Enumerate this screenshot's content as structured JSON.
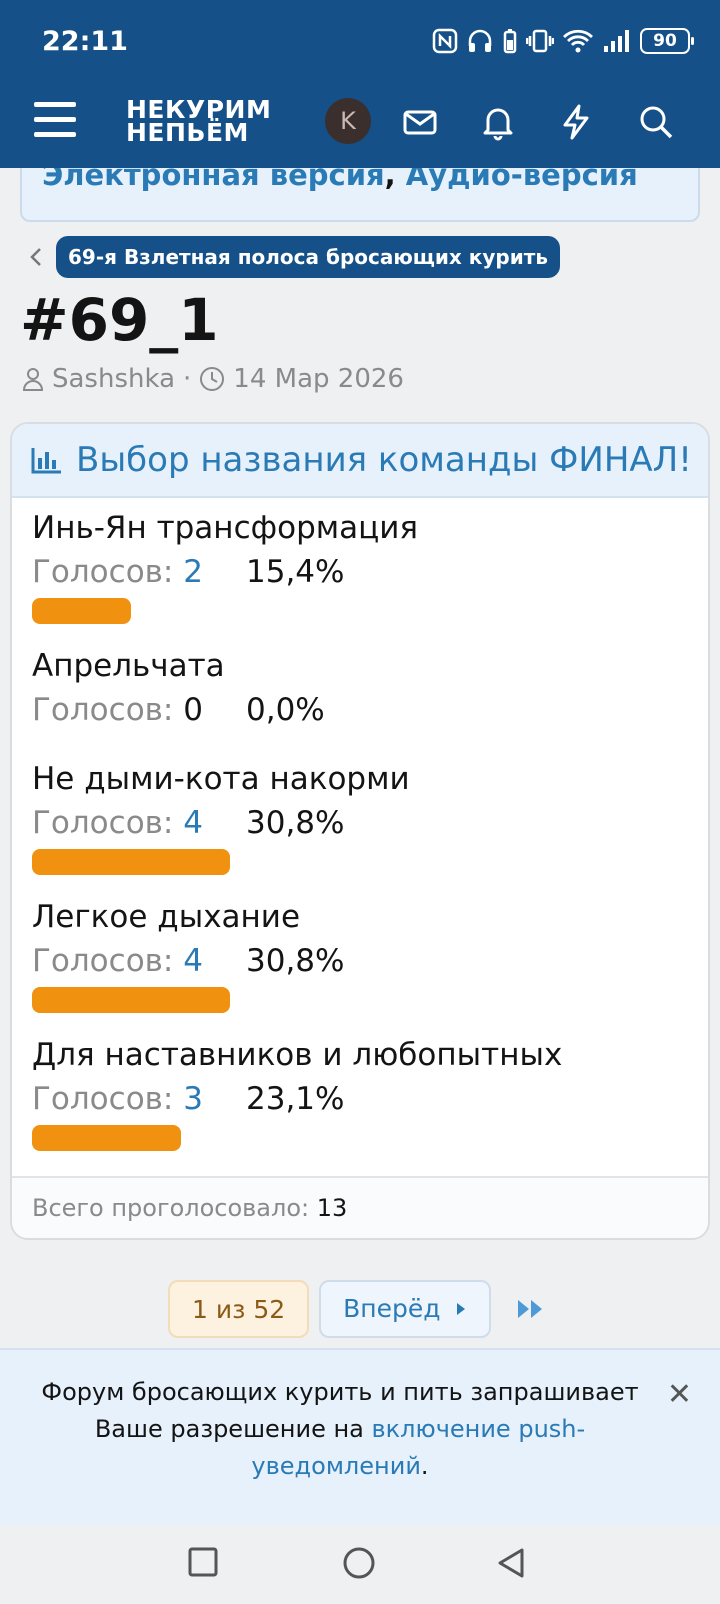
{
  "status_bar": {
    "time": "22:11",
    "battery": "90"
  },
  "header": {
    "logo_line1": "НЕКУРИМ",
    "logo_line2": "НЕПЬЁМ",
    "avatar_letter": "K"
  },
  "notice": {
    "link1": "Электронная версия",
    "separator": ", ",
    "link2": "Аудио-версия"
  },
  "breadcrumb": {
    "label": "69-я Взлетная полоса бросающих курить"
  },
  "thread": {
    "title": "#69_1",
    "author": "Sashshka",
    "dot": "·",
    "date": "14 Мар 2026"
  },
  "poll": {
    "title": "Выбор названия команды ФИНАЛ!",
    "votes_label": "Голосов:",
    "options": [
      {
        "name": "Инь-Ян трансформация",
        "votes": "2",
        "percent": "15,4%",
        "fraction": 0.154
      },
      {
        "name": "Апрельчата",
        "votes": "0",
        "percent": "0,0%",
        "fraction": 0.0
      },
      {
        "name": "Не дыми-кота накорми",
        "votes": "4",
        "percent": "30,8%",
        "fraction": 0.308
      },
      {
        "name": "Легкое дыхание",
        "votes": "4",
        "percent": "30,8%",
        "fraction": 0.308
      },
      {
        "name": "Для наставников и любопытных",
        "votes": "3",
        "percent": "23,1%",
        "fraction": 0.231
      }
    ],
    "total_label": "Всего проголосовало:",
    "total": "13"
  },
  "pagination": {
    "current": "1 из 52",
    "next_label": "Вперёд"
  },
  "push_notice": {
    "text_before": "Форум бросающих курить и пить запрашивает Ваше разрешение на ",
    "link": "включение push-уведомлений",
    "text_after": "."
  },
  "colors": {
    "header_bg": "#155088",
    "accent": "#2a7ab6",
    "bar": "#f0910f"
  }
}
